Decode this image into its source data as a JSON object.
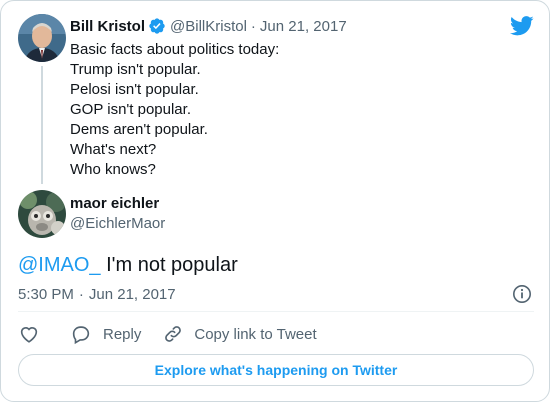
{
  "colors": {
    "accent": "#1d9bf0",
    "text": "#0f1419",
    "muted": "#536471",
    "border": "#cfd9de"
  },
  "parent_tweet": {
    "author_name": "Bill Kristol",
    "verified_icon": "verified-badge-icon",
    "handle": "@BillKristol",
    "separator": "·",
    "date": "Jun 21, 2017",
    "lines": [
      "Basic facts about politics today:",
      "Trump isn't popular.",
      "Pelosi isn't popular.",
      "GOP isn't popular.",
      "Dems aren't popular.",
      "What's next?",
      "Who knows?"
    ]
  },
  "reply_tweet": {
    "author_name": "maor eichler",
    "handle": "@EichlerMaor",
    "mention": "@IMAO_",
    "text": " I'm not popular",
    "time": "5:30 PM",
    "separator": "·",
    "date": "Jun 21, 2017"
  },
  "actions": {
    "like_icon": "heart-icon",
    "reply_icon": "comment-icon",
    "reply_label": "Reply",
    "copy_icon": "link-icon",
    "copy_label": "Copy link to Tweet"
  },
  "explore_button": {
    "label": "Explore what's happening on Twitter"
  },
  "icons": {
    "logo": "twitter-bird-icon",
    "info": "info-icon"
  }
}
